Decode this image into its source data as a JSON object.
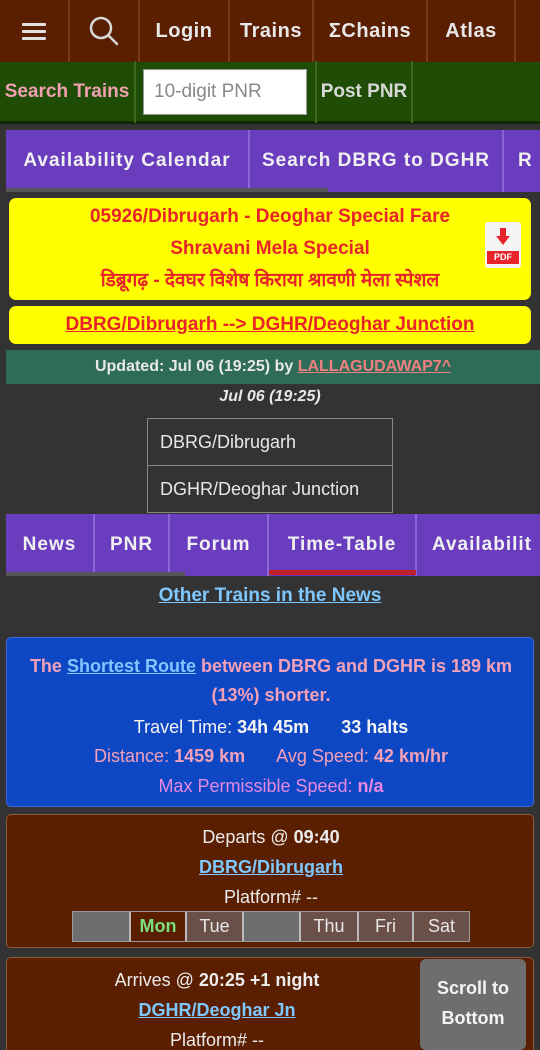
{
  "topnav": {
    "login": "Login",
    "trains": "Trains",
    "chains": "ΣChains",
    "atlas": "Atlas"
  },
  "searchbar": {
    "label": "Search Trains",
    "pnr_placeholder": "10-digit PNR",
    "post_pnr": "Post PNR"
  },
  "tabs1": [
    "Availability Calendar",
    "Search DBRG to DGHR",
    "R"
  ],
  "train": {
    "line1": "05926/Dibrugarh - Deoghar Special Fare",
    "line2": "Shravani Mela Special",
    "line3": "डिब्रूगढ़ - देवघर विशेष किराया श्रावणी मेला स्पेशल",
    "pdf_label": "PDF",
    "route": "DBRG/Dibrugarh --> DGHR/Deoghar Junction"
  },
  "updated": {
    "prefix": "Updated: Jul 06 (19:25) by ",
    "user": "LALLAGUDAWAP7^",
    "time": "Jul 06 (19:25)"
  },
  "stations": {
    "from": "DBRG/Dibrugarh",
    "to": "DGHR/Deoghar Junction"
  },
  "tabs2": [
    "News",
    "PNR",
    "Forum",
    "Time-Table",
    "Availabilit"
  ],
  "other_news": "Other Trains in the News",
  "info": {
    "shortest_pre": "The ",
    "shortest_link": "Shortest Route",
    "shortest_post": " between DBRG and DGHR is 189 km (13%) shorter.",
    "travel_time_label": "Travel Time: ",
    "travel_time": "34h 45m",
    "halts": "33 halts",
    "distance_label": "Distance: ",
    "distance": "1459 km",
    "speed_label": "Avg Speed: ",
    "speed": "42 km/hr",
    "mps_label": "Max Permissible Speed: ",
    "mps": "n/a"
  },
  "departs": {
    "label": "Departs @ ",
    "time": "09:40",
    "station": "DBRG/Dibrugarh",
    "platform": "Platform# --",
    "days": [
      "",
      "Mon",
      "Tue",
      "",
      "Thu",
      "Fri",
      "Sat"
    ]
  },
  "arrives": {
    "label": "Arrives @ ",
    "time": "20:25 +1 night",
    "station": "DGHR/Deoghar Jn",
    "platform": "Platform# --"
  },
  "scroll_bottom": {
    "line1": "Scroll to",
    "line2": "Bottom"
  },
  "colors": {
    "nav_bg": "#5a1e00",
    "search_bg": "#1f4d05",
    "tab_bg": "#6a3dbf",
    "title_bg": "#ffff00",
    "title_text": "#e8232a",
    "info_bg": "#0d47c4"
  }
}
